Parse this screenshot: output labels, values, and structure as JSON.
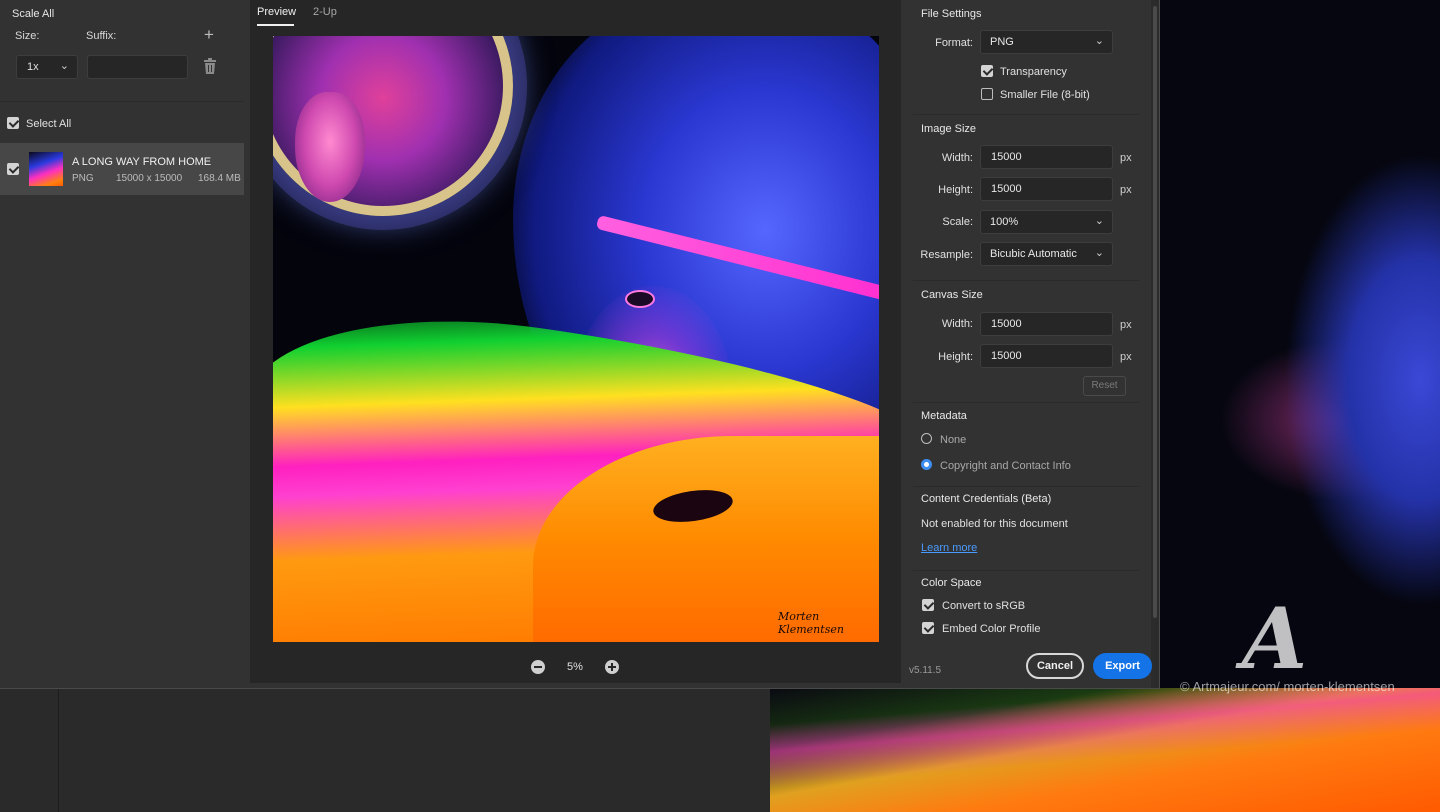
{
  "left_panel": {
    "title": "Scale All",
    "size_label": "Size:",
    "suffix_label": "Suffix:",
    "scale_value": "1x",
    "suffix_value": "",
    "select_all_label": "Select All",
    "select_all_checked": true,
    "assets": [
      {
        "name": "A LONG WAY FROM HOME",
        "format": "PNG",
        "dimensions": "15000 x 15000",
        "size": "168.4 MB",
        "checked": true
      }
    ]
  },
  "preview": {
    "tabs": [
      "Preview",
      "2-Up"
    ],
    "active_tab": "Preview",
    "zoom": "5%"
  },
  "file_settings": {
    "title": "File Settings",
    "format_label": "Format:",
    "format_value": "PNG",
    "transparency_label": "Transparency",
    "transparency_checked": true,
    "smaller_file_label": "Smaller File (8-bit)",
    "smaller_file_checked": false
  },
  "image_size": {
    "title": "Image Size",
    "width_label": "Width:",
    "width_value": "15000",
    "height_label": "Height:",
    "height_value": "15000",
    "unit": "px",
    "scale_label": "Scale:",
    "scale_value": "100%",
    "resample_label": "Resample:",
    "resample_value": "Bicubic Automatic"
  },
  "canvas_size": {
    "title": "Canvas Size",
    "width_label": "Width:",
    "width_value": "15000",
    "height_label": "Height:",
    "height_value": "15000",
    "unit": "px",
    "reset_label": "Reset"
  },
  "metadata": {
    "title": "Metadata",
    "options": [
      "None",
      "Copyright and Contact Info"
    ],
    "selected": "Copyright and Contact Info"
  },
  "content_credentials": {
    "title": "Content Credentials (Beta)",
    "status": "Not enabled for this document",
    "link": "Learn more"
  },
  "color_space": {
    "title": "Color Space",
    "convert_label": "Convert to sRGB",
    "convert_checked": true,
    "embed_label": "Embed Color Profile",
    "embed_checked": true
  },
  "footer": {
    "version": "v5.11.5",
    "cancel_label": "Cancel",
    "export_label": "Export"
  },
  "watermark": {
    "url": "© Artmajeur.com/ morten-klementsen"
  },
  "colors": {
    "accent": "#1473e6",
    "link": "#4a9bff",
    "dialog_bg": "#323232",
    "preview_bg": "#262626"
  }
}
